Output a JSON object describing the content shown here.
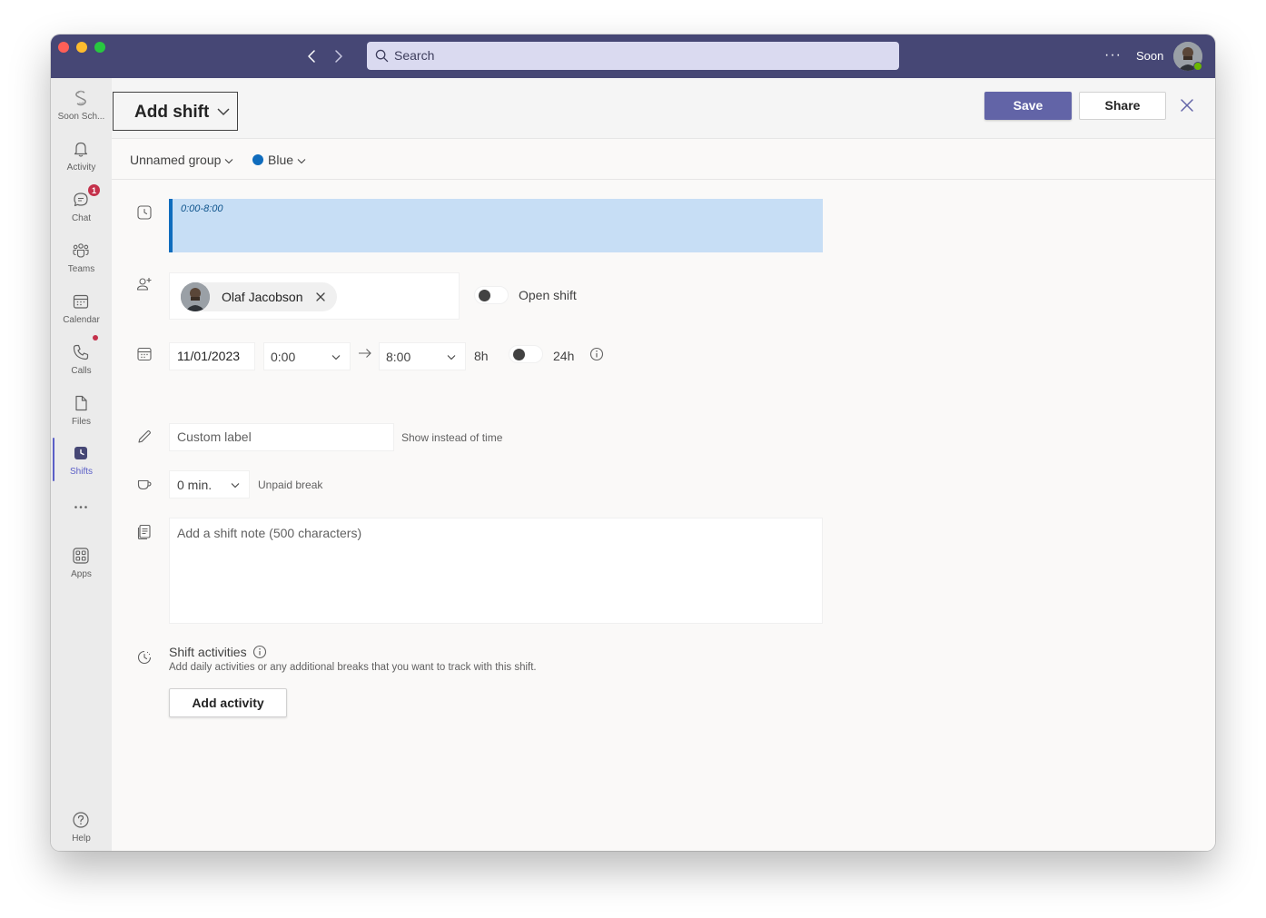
{
  "titlebar": {
    "search_placeholder": "Search",
    "more_label": "···",
    "user_name": "Soon",
    "presence": "available"
  },
  "rail": {
    "items": [
      {
        "label": "Soon Sch...",
        "icon": "org-logo-icon"
      },
      {
        "label": "Activity",
        "icon": "bell-icon"
      },
      {
        "label": "Chat",
        "icon": "chat-icon",
        "badge": "1"
      },
      {
        "label": "Teams",
        "icon": "teams-icon"
      },
      {
        "label": "Calendar",
        "icon": "calendar-icon"
      },
      {
        "label": "Calls",
        "icon": "phone-icon"
      },
      {
        "label": "Files",
        "icon": "file-icon"
      },
      {
        "label": "Shifts",
        "icon": "shifts-icon",
        "active": true
      },
      {
        "label": "···",
        "icon": "more-icon"
      },
      {
        "label": "Apps",
        "icon": "apps-icon"
      },
      {
        "label": "Help",
        "icon": "help-icon"
      }
    ]
  },
  "header": {
    "title": "Add shift",
    "save_label": "Save",
    "share_label": "Share"
  },
  "subheader": {
    "group": "Unnamed group",
    "color": "Blue",
    "color_hex": "#0f6cbd"
  },
  "shift": {
    "preview_time": "0:00-8:00",
    "member_name": "Olaf Jacobson",
    "open_shift_label": "Open shift",
    "open_shift_on": false,
    "date": "11/01/2023",
    "start_time": "0:00",
    "end_time": "8:00",
    "duration": "8h",
    "all_day_label": "24h",
    "all_day_on": false,
    "custom_label_placeholder": "Custom label",
    "custom_label_hint": "Show instead of time",
    "break_value": "0 min.",
    "break_label": "Unpaid break",
    "note_placeholder": "Add a shift note (500 characters)"
  },
  "activities": {
    "title": "Shift activities",
    "description": "Add daily activities or any additional breaks that you want to track with this shift.",
    "add_label": "Add activity"
  }
}
